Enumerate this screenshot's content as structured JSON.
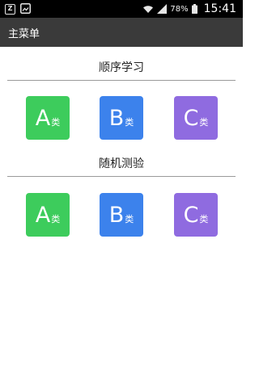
{
  "status_bar": {
    "notification_icon_letter": "Z",
    "battery_percent": "78%",
    "time": "15:41",
    "icons": [
      "notification-z-icon",
      "image-icon",
      "wifi-icon",
      "signal-icon",
      "battery-icon"
    ]
  },
  "app_bar": {
    "title": "主菜单"
  },
  "sections": [
    {
      "title": "顺序学习",
      "tiles": [
        {
          "letter": "A",
          "suffix": "类",
          "color": "#3dcc5c"
        },
        {
          "letter": "B",
          "suffix": "类",
          "color": "#3c82ec"
        },
        {
          "letter": "C",
          "suffix": "类",
          "color": "#8f6be0"
        }
      ]
    },
    {
      "title": "随机测验",
      "tiles": [
        {
          "letter": "A",
          "suffix": "类",
          "color": "#3dcc5c"
        },
        {
          "letter": "B",
          "suffix": "类",
          "color": "#3c82ec"
        },
        {
          "letter": "C",
          "suffix": "类",
          "color": "#8f6be0"
        }
      ]
    }
  ]
}
